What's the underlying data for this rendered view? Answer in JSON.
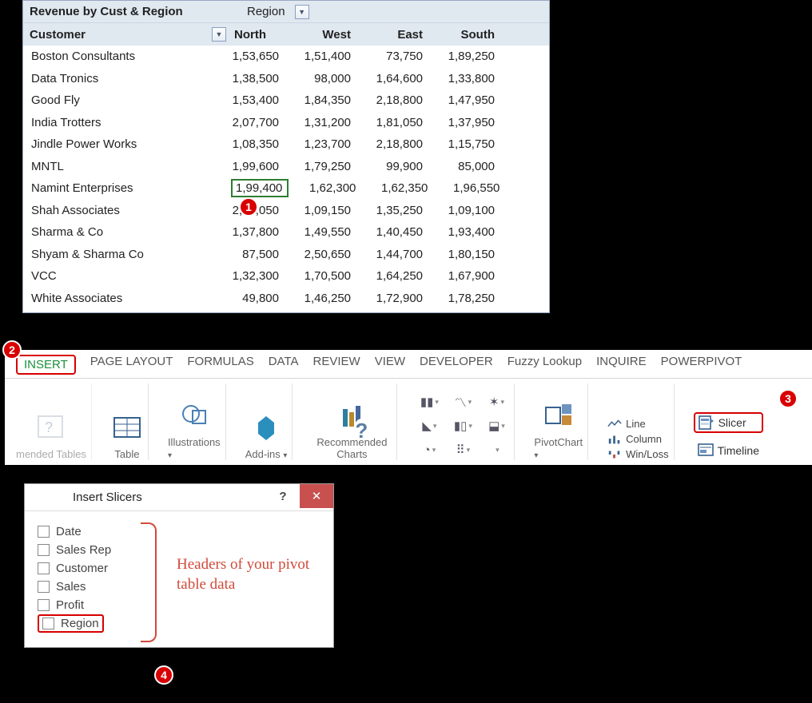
{
  "pivot": {
    "title": "Revenue by Cust & Region",
    "regionLabel": "Region",
    "customerHeading": "Customer",
    "columns": [
      "North",
      "West",
      "East",
      "South"
    ],
    "rows": [
      {
        "name": "Boston Consultants",
        "vals": [
          "1,53,650",
          "1,51,400",
          "73,750",
          "1,89,250"
        ]
      },
      {
        "name": "Data Tronics",
        "vals": [
          "1,38,500",
          "98,000",
          "1,64,600",
          "1,33,800"
        ]
      },
      {
        "name": "Good Fly",
        "vals": [
          "1,53,400",
          "1,84,350",
          "2,18,800",
          "1,47,950"
        ]
      },
      {
        "name": "India Trotters",
        "vals": [
          "2,07,700",
          "1,31,200",
          "1,81,050",
          "1,37,950"
        ]
      },
      {
        "name": "Jindle Power Works",
        "vals": [
          "1,08,350",
          "1,23,700",
          "2,18,800",
          "1,15,750"
        ]
      },
      {
        "name": "MNTL",
        "vals": [
          "1,99,600",
          "1,79,250",
          "99,900",
          "85,000"
        ]
      },
      {
        "name": "Namint Enterprises",
        "vals": [
          "1,99,400",
          "1,62,300",
          "1,62,350",
          "1,96,550"
        ],
        "sel": 0
      },
      {
        "name": "Shah Associates",
        "vals": [
          "2,69,050",
          "1,09,150",
          "1,35,250",
          "1,09,100"
        ]
      },
      {
        "name": "Sharma & Co",
        "vals": [
          "1,37,800",
          "1,49,550",
          "1,40,450",
          "1,93,400"
        ]
      },
      {
        "name": "Shyam & Sharma Co",
        "vals": [
          "87,500",
          "2,50,650",
          "1,44,700",
          "1,80,150"
        ]
      },
      {
        "name": "VCC",
        "vals": [
          "1,32,300",
          "1,70,500",
          "1,64,250",
          "1,67,900"
        ]
      },
      {
        "name": "White Associates",
        "vals": [
          "49,800",
          "1,46,250",
          "1,72,900",
          "1,78,250"
        ]
      }
    ]
  },
  "ribbon": {
    "tabs": [
      "INSERT",
      "PAGE LAYOUT",
      "FORMULAS",
      "DATA",
      "REVIEW",
      "VIEW",
      "DEVELOPER",
      "Fuzzy Lookup",
      "INQUIRE",
      "POWERPIVOT"
    ],
    "activeTab": 0,
    "groups": {
      "recTables": "mended Tables",
      "table": "Table",
      "illus": "Illustrations",
      "addins": "Add-ins",
      "recCharts": "Recommended Charts",
      "pivotChart": "PivotChart",
      "sparkLine": "Line",
      "sparkCol": "Column",
      "sparkWL": "Win/Loss",
      "slicer": "Slicer",
      "timeline": "Timeline"
    }
  },
  "dialog": {
    "title": "Insert Slicers",
    "fields": [
      "Date",
      "Sales Rep",
      "Customer",
      "Sales",
      "Profit",
      "Region"
    ],
    "highlight": 5,
    "annotation": "Headers of your pivot table data"
  },
  "badges": {
    "b1": "1",
    "b2": "2",
    "b3": "3",
    "b4": "4"
  }
}
